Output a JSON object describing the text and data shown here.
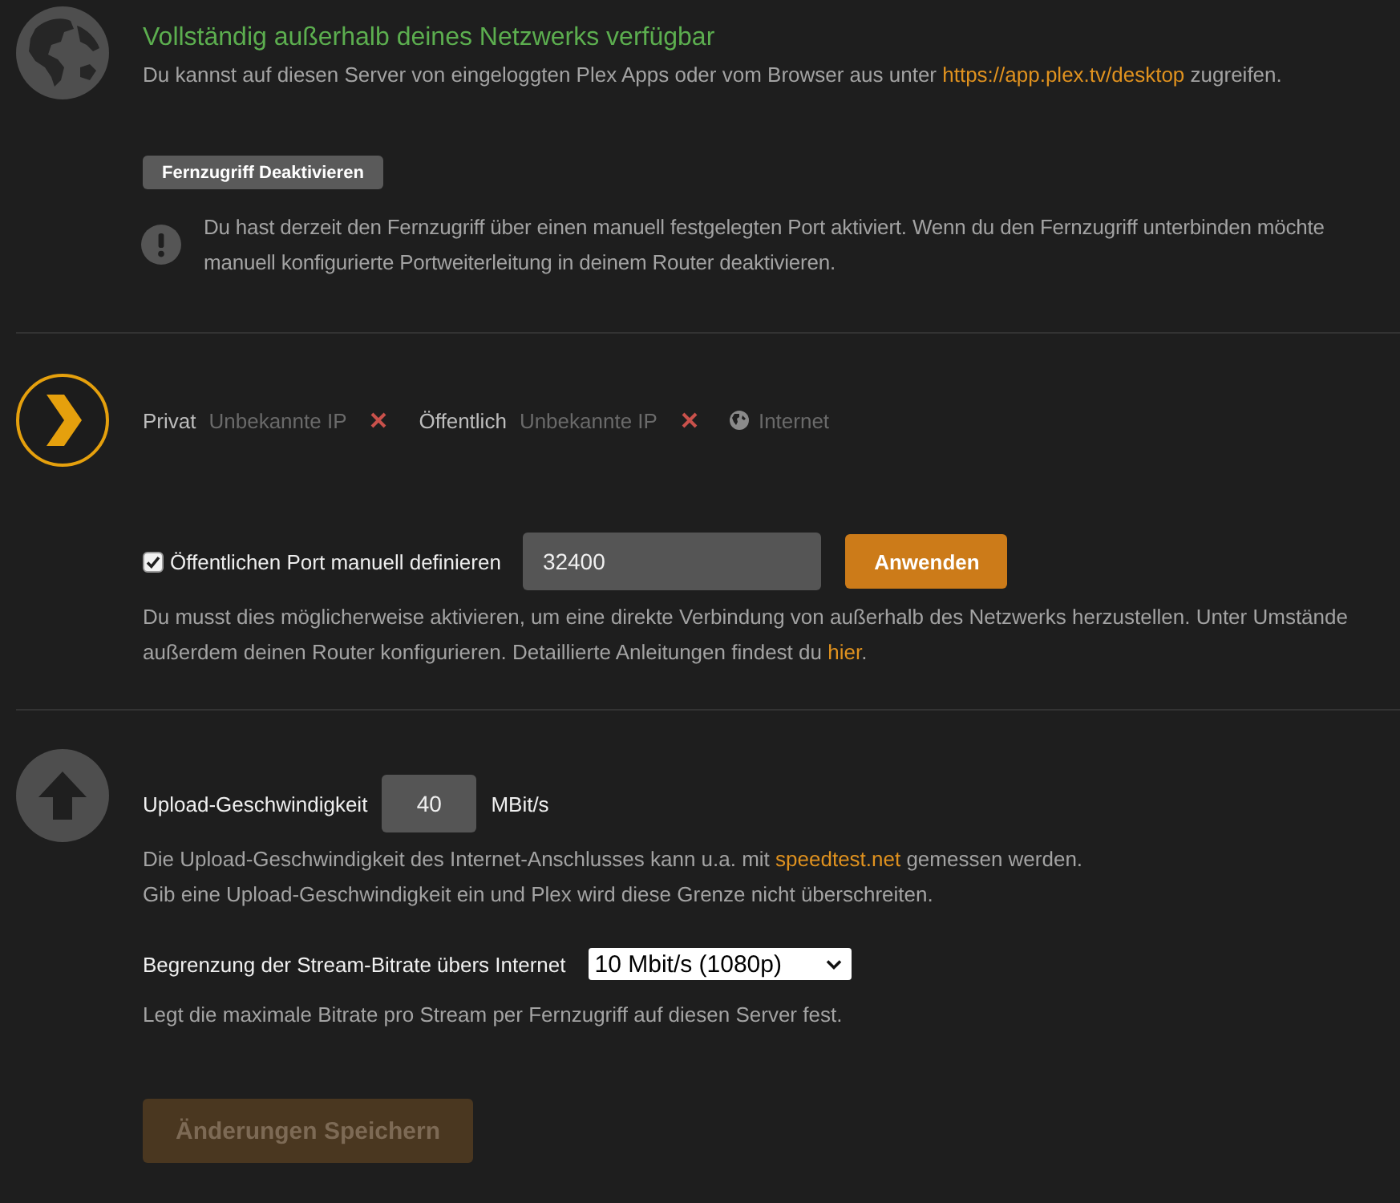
{
  "availability": {
    "title": "Vollständig außerhalb deines Netzwerks verfügbar",
    "description": {
      "before": "Du kannst auf diesen Server von eingeloggten Plex Apps oder vom Browser aus unter ",
      "link": "https://app.plex.tv/desktop",
      "after": " zugreifen."
    }
  },
  "disable_button": {
    "label": "Fernzugriff Deaktivieren"
  },
  "notice": {
    "lines": [
      "Du hast derzeit den Fernzugriff über einen manuell festgelegten Port aktiviert. Wenn du den Fernzugriff unterbinden möchte",
      "manuell konfigurierte Portweiterleitung in deinem Router deaktivieren."
    ]
  },
  "connection": {
    "items": [
      {
        "label": "Privat",
        "value": "Unbekannte IP",
        "reachable": false
      },
      {
        "label": "Öffentlich",
        "value": "Unbekannte IP",
        "reachable": false
      }
    ],
    "internet": {
      "label": "Internet"
    }
  },
  "manual_port": {
    "checked": true,
    "label": "Öffentlichen Port manuell definieren",
    "value": "32400",
    "button": "Anwenden",
    "help": {
      "lines": [
        "Du musst dies möglicherweise aktivieren, um eine direkte Verbindung von außerhalb des Netzwerks herzustellen. Unter Umstände",
        "außerdem deinen Router konfigurieren. Detaillierte Anleitungen findest du "
      ],
      "link": "hier",
      "after": "."
    }
  },
  "upload": {
    "label": "Upload-Geschwindigkeit",
    "value": "40",
    "unit": "MBit/s",
    "help": [
      {
        "before": "Die Upload-Geschwindigkeit des Internet-Anschlusses kann u.a. mit ",
        "link": "speedtest.net",
        "after": " gemessen werden."
      },
      {
        "before": "Gib eine Upload-Geschwindigkeit ein und Plex wird diese Grenze nicht überschreiten."
      }
    ]
  },
  "stream_limit": {
    "label": "Begrenzung der Stream-Bitrate übers Internet",
    "value": "10 Mbit/s (1080p)",
    "help": "Legt die maximale Bitrate pro Stream per Fernzugriff auf diesen Server fest."
  },
  "save_button": {
    "label": "Änderungen Speichern",
    "disabled": true
  }
}
